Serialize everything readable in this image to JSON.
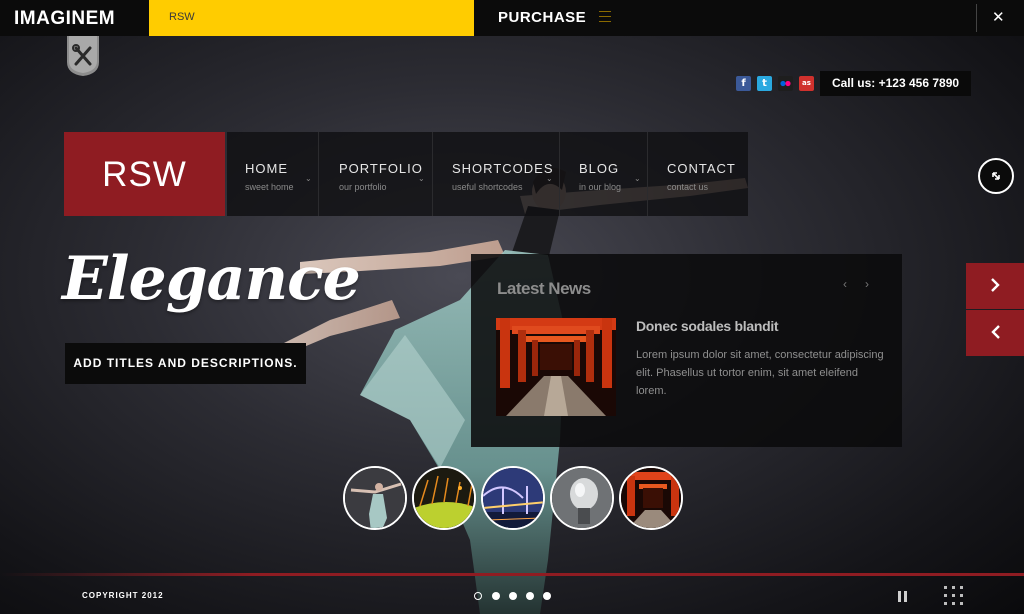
{
  "topbar": {
    "brand": "IMAGINEM",
    "demo_select": "RSW",
    "purchase": "PURCHASE",
    "close_glyph": "✕"
  },
  "contact": {
    "phone": "Call us: +123 456 7890",
    "social": [
      {
        "name": "facebook",
        "glyph": "f",
        "color": "#3b5998"
      },
      {
        "name": "twitter",
        "glyph": "t",
        "color": "#2aa9e0"
      },
      {
        "name": "flickr",
        "glyph": "●",
        "color": "#1e1e1e"
      },
      {
        "name": "lastfm",
        "glyph": "as",
        "color": "#d0312d"
      }
    ]
  },
  "logo": {
    "text": "RSW",
    "color": "#8f1c22"
  },
  "nav": [
    {
      "label": "HOME",
      "sub": "sweet home",
      "has_dropdown": true
    },
    {
      "label": "PORTFOLIO",
      "sub": "our portfolio",
      "has_dropdown": true
    },
    {
      "label": "SHORTCODES",
      "sub": "useful shortcodes",
      "has_dropdown": true
    },
    {
      "label": "BLOG",
      "sub": "in our blog",
      "has_dropdown": true
    },
    {
      "label": "CONTACT",
      "sub": "contact us",
      "has_dropdown": false
    }
  ],
  "slide": {
    "headline": "Elegance",
    "caption": "ADD TITLES AND DESCRIPTIONS."
  },
  "news": {
    "title": "Latest News",
    "prev_glyph": "‹",
    "next_glyph": "›",
    "item_title": "Donec sodales blandit",
    "item_body": "Lorem ipsum dolor sit amet, consectetur adipiscing elit. Phasellus ut tortor enim, sit amet eleifend lorem."
  },
  "thumbnails": [
    {
      "name": "dancer"
    },
    {
      "name": "grass"
    },
    {
      "name": "bridge"
    },
    {
      "name": "bulb"
    },
    {
      "name": "torii"
    }
  ],
  "footer": {
    "copyright": "COPYRIGHT 2012",
    "slide_count": 5,
    "active_slide": 1
  },
  "colors": {
    "accent_red": "#8f1c22",
    "accent_yellow": "#ffcc00",
    "bar_black": "#0b0b0b"
  }
}
